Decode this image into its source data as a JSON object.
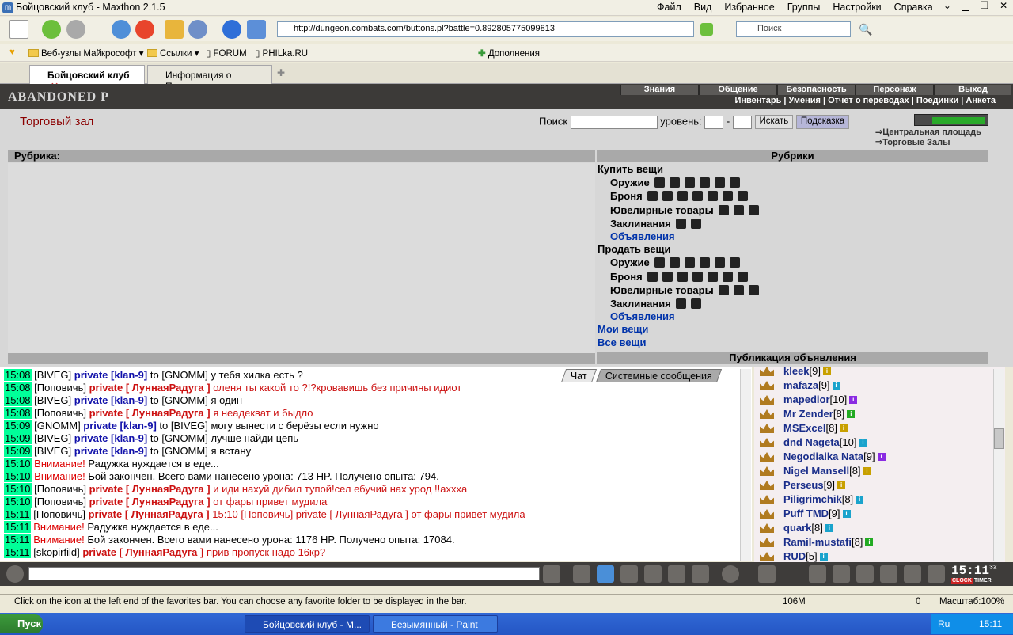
{
  "window": {
    "title": "Бойцовский клуб - Maxthon 2.1.5",
    "menu": [
      "Файл",
      "Вид",
      "Избранное",
      "Группы",
      "Настройки",
      "Справка"
    ]
  },
  "toolbar": {
    "url": "http://dungeon.combats.com/buttons.pl?battle=0.892805775099813",
    "search_placeholder": "Поиск"
  },
  "favorites": {
    "items": [
      "Веб-узлы Майкрософт",
      "Ссылки",
      "FORUM",
      "PHILka.RU"
    ],
    "addons": "Дополнения"
  },
  "tabs": [
    {
      "label": "Бойцовский клуб"
    },
    {
      "label": "Информация о Поповичь"
    }
  ],
  "banner": {
    "logo": "ABANDONED P",
    "nav_top": [
      "Знания",
      "Общение",
      "Безопасность",
      "Персонаж",
      "Выход"
    ],
    "nav_bottom": "Инвентарь | Умения | Отчет о переводах | Поединки | Анкета"
  },
  "page": {
    "heading": "Торговый зал",
    "search_label": "Поиск",
    "level_label": "уровень:",
    "dash": "-",
    "search_button": "Искать",
    "hint_button": "Подсказка",
    "side_links": [
      "Центральная площадь",
      "Торговые Залы"
    ],
    "rubric_label": "Рубрика:",
    "rubrics_title": "Рубрики",
    "publication_title": "Публикация объявления",
    "buy": {
      "title": "Купить вещи",
      "items": [
        "Оружие",
        "Броня",
        "Ювелирные товары",
        "Заклинания"
      ],
      "ads": "Объявления"
    },
    "sell": {
      "title": "Продать вещи",
      "items": [
        "Оружие",
        "Броня",
        "Ювелирные товары",
        "Заклинания"
      ],
      "ads": "Объявления"
    },
    "my_items": "Мои вещи",
    "all_items": "Все вещи"
  },
  "chat": {
    "tabs": [
      "Чат",
      "Системные сообщения"
    ],
    "lines": [
      {
        "t": "15:08",
        "n": "BIVEG",
        "k": "private [klan-9]",
        "to": "to [GNOMM]",
        "m": "у тебя хилка есть ?",
        "kc": "blue"
      },
      {
        "t": "15:08",
        "n": "Поповичь",
        "k": "private [ ЛуннаяРадуга ]",
        "to": "",
        "m": "оленя ты какой то ?!?кровавишь без причины идиот",
        "kc": "red"
      },
      {
        "t": "15:08",
        "n": "BIVEG",
        "k": "private [klan-9]",
        "to": "to [GNOMM]",
        "m": "я один",
        "kc": "blue"
      },
      {
        "t": "15:08",
        "n": "Поповичь",
        "k": "private [ ЛуннаяРадуга ]",
        "to": "",
        "m": "я неадекват и быдло",
        "kc": "red"
      },
      {
        "t": "15:09",
        "n": "GNOMM",
        "k": "private [klan-9]",
        "to": "to [BIVEG]",
        "m": "могу вынести с берёзы если нужно",
        "kc": "blue"
      },
      {
        "t": "15:09",
        "n": "BIVEG",
        "k": "private [klan-9]",
        "to": "to [GNOMM]",
        "m": "лучше найди цепь",
        "kc": "blue"
      },
      {
        "t": "15:09",
        "n": "BIVEG",
        "k": "private [klan-9]",
        "to": "to [GNOMM]",
        "m": "я встану",
        "kc": "blue"
      },
      {
        "t": "15:10",
        "w": "Внимание!",
        "m": "Радужка нуждается в еде..."
      },
      {
        "t": "15:10",
        "w": "Внимание!",
        "m": "Бой закончен. Всего вами нанесено урона: 713 HP. Получено опыта: 794."
      },
      {
        "t": "15:10",
        "n": "Поповичь",
        "k": "private [ ЛуннаяРадуга ]",
        "to": "",
        "m": "и иди нахуй дибил тупой!сел ебучий нах урод !!ахххa",
        "kc": "red"
      },
      {
        "t": "15:10",
        "n": "Поповичь",
        "k": "private [ ЛуннаяРадуга ]",
        "to": "",
        "m": "от фары привет мудила",
        "kc": "red"
      },
      {
        "t": "15:11",
        "n": "Поповичь",
        "k": "private [ ЛуннаяРадуга ]",
        "to": "",
        "m": "15:10 [Поповичь] private [ ЛуннаяРадуга ] от фары привет мудила",
        "kc": "red"
      },
      {
        "t": "15:11",
        "w": "Внимание!",
        "m": "Радужка нуждается в еде..."
      },
      {
        "t": "15:11",
        "w": "Внимание!",
        "m": "Бой закончен. Всего вами нанесено урона: 1176 HP. Получено опыта: 17084."
      },
      {
        "t": "15:11",
        "n": "skopirfild",
        "k": "private [ ЛуннаяРадуга ]",
        "to": "",
        "m": "прив пропуск надо 16кр?",
        "kc": "red"
      }
    ]
  },
  "users": [
    {
      "name": "kleek",
      "lvl": "[9]",
      "c": "#c8a000"
    },
    {
      "name": "mafaza",
      "lvl": "[9]",
      "c": "#1aa3cc"
    },
    {
      "name": "mapedior",
      "lvl": "[10]",
      "c": "#8a2be2"
    },
    {
      "name": "Mr Zender",
      "lvl": "[8]",
      "c": "#22aa22"
    },
    {
      "name": "MSExcel",
      "lvl": "[8]",
      "c": "#c8a000"
    },
    {
      "name": "dnd Nageta",
      "lvl": "[10]",
      "c": "#1aa3cc"
    },
    {
      "name": "Negodiaika Nata",
      "lvl": "[9]",
      "c": "#8a2be2"
    },
    {
      "name": "Nigel Mansell",
      "lvl": "[8]",
      "c": "#c8a000"
    },
    {
      "name": "Perseus",
      "lvl": "[9]",
      "c": "#c8a000"
    },
    {
      "name": "Piligrimchik",
      "lvl": "[8]",
      "c": "#1aa3cc"
    },
    {
      "name": "Puff TMD",
      "lvl": "[9]",
      "c": "#1aa3cc"
    },
    {
      "name": "quark",
      "lvl": "[8]",
      "c": "#1aa3cc"
    },
    {
      "name": "Ramil-mustafi",
      "lvl": "[8]",
      "c": "#22aa22"
    },
    {
      "name": "RUD",
      "lvl": "[5]",
      "c": "#1aa3cc"
    }
  ],
  "clock": {
    "time": "15:11",
    "seconds": "32",
    "label1": "CLOCK",
    "label2": "TIMER"
  },
  "status": {
    "message": "Click on the icon at the left end of the favorites bar. You can choose any favorite folder to be displayed in the bar.",
    "memory": "106M",
    "count": "0",
    "zoom": "Масштаб:100%"
  },
  "taskbar": {
    "start": "Пуск",
    "tasks": [
      "Бойцовский клуб - M...",
      "Безымянный - Paint"
    ],
    "lang": "Ru",
    "time": "15:11"
  }
}
